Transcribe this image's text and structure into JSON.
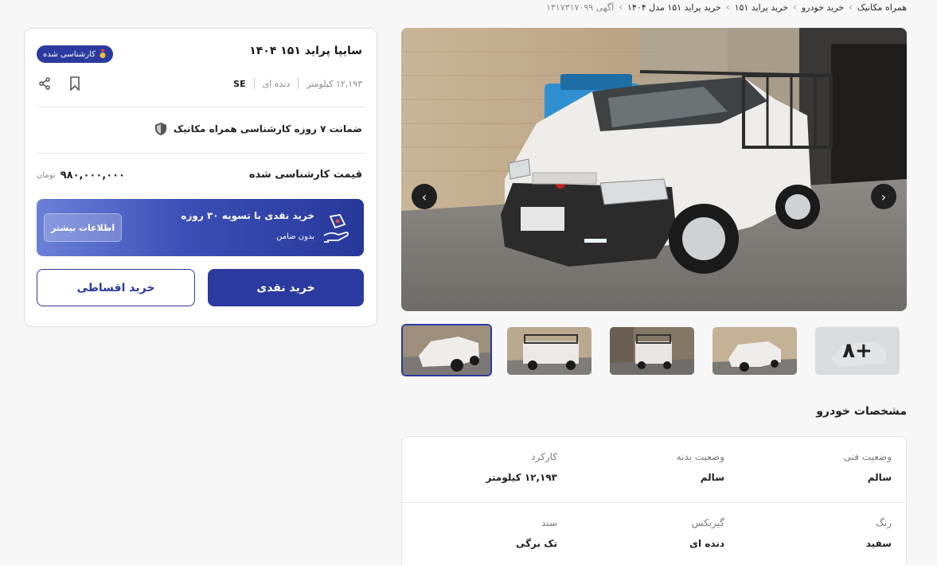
{
  "breadcrumb": {
    "items": [
      "همراه مکانیک",
      "خرید خودرو",
      "خرید پراید ۱۵۱",
      "خرید پراید ۱۵۱ مدل ۱۴۰۴"
    ],
    "ad_id": "آگهی ۱۳۱۷۳۱۷۰۹۹"
  },
  "listing": {
    "title": "سایپا پراید ۱۵۱ ۱۴۰۴",
    "badge": "کارشناسی شده",
    "trim": "SE",
    "gearbox": "دنده ای",
    "mileage": "۱۲,۱۹۳ کیلومتر",
    "warranty": "ضمانت ۷ روزه کارشناسی همراه مکانیک",
    "price_label": "قیمت کارشناسی شده",
    "price": "۹۸۰,۰۰۰,۰۰۰",
    "price_unit": "تومان"
  },
  "promo": {
    "title": "خرید نقدی با تسویه ۳۰ روزه",
    "subtitle": "بدون ضامن",
    "button": "اطلاعات بیشتر"
  },
  "actions": {
    "cash": "خرید نقدی",
    "installment": "خرید اقساطی"
  },
  "gallery": {
    "more_count": "۸+"
  },
  "specs": {
    "title": "مشخصات خودرو",
    "rows": [
      [
        {
          "key": "وضعیت فنی",
          "value": "سالم"
        },
        {
          "key": "وضعیت بدنه",
          "value": "سالم"
        },
        {
          "key": "کارکرد",
          "value": "۱۲,۱۹۳ کیلومتر"
        }
      ],
      [
        {
          "key": "رنگ",
          "value": "سفید"
        },
        {
          "key": "گیربکس",
          "value": "دنده ای"
        },
        {
          "key": "سند",
          "value": "تک برگی"
        }
      ]
    ]
  },
  "colors": {
    "primary": "#2b3a9f",
    "badge": "#2b3a9f"
  }
}
